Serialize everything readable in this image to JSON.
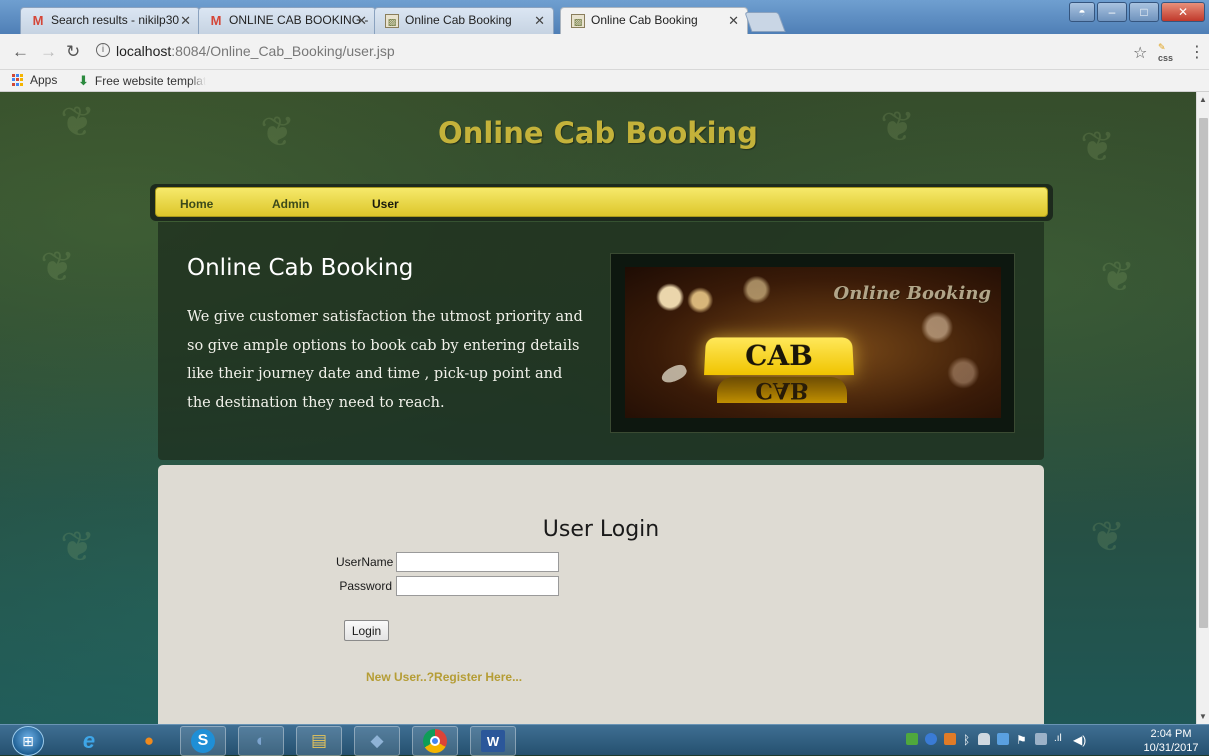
{
  "browser": {
    "tabs": [
      {
        "title": "Search results - nikilp30",
        "icon": "gmail-icon"
      },
      {
        "title": "ONLINE CAB BOOKING -",
        "icon": "gmail-icon"
      },
      {
        "title": "Online Cab Booking",
        "icon": "page-image-icon"
      },
      {
        "title": "Online Cab Booking",
        "icon": "page-image-icon",
        "active": true
      }
    ],
    "url_host": "localhost",
    "url_path": ":8084/Online_Cab_Booking/user.jsp",
    "bookmarks": [
      "Apps",
      "Free website templat"
    ],
    "extension_label": "css"
  },
  "page": {
    "site_title": "Online Cab Booking",
    "nav": [
      "Home",
      "Admin",
      "User"
    ],
    "active_nav": "User",
    "hero_title": "Online Cab Booking",
    "hero_text": "We give customer satisfaction the utmost priority and so give ample options to book cab by entering details like their journey date and time , pick-up point and the destination they need to reach.",
    "hero_image": {
      "script_text": "Online Booking",
      "sign_text": "CAB",
      "reflection_text": "CAB"
    },
    "login": {
      "title": "User Login",
      "username_label": "UserName",
      "password_label": "Password",
      "username_value": "",
      "password_value": "",
      "button_label": "Login",
      "register_link": "New User..?Register Here..."
    },
    "colors": {
      "title_gold": "#c4b23a",
      "nav_yellow": "#f6e96b",
      "register_link": "#b59d35"
    }
  },
  "taskbar": {
    "apps": [
      "internet-explorer-icon",
      "firefox-icon",
      "skype-icon",
      "dolphin-icon",
      "file-explorer-icon",
      "virtualbox-icon",
      "chrome-icon",
      "word-icon"
    ],
    "time": "2:04 PM",
    "date": "10/31/2017"
  }
}
